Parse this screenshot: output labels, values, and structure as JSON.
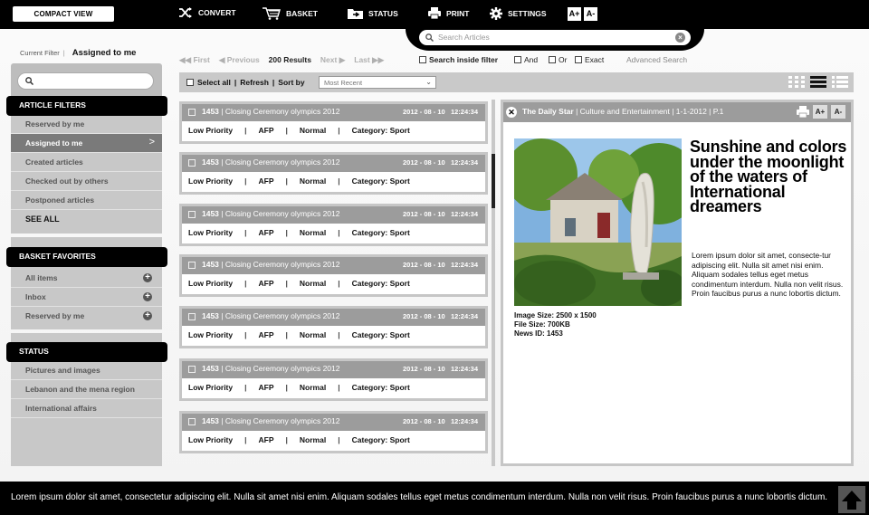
{
  "topbar": {
    "compact_view": "COMPACT VIEW",
    "convert": "CONVERT",
    "basket": "BASKET",
    "status": "STATUS",
    "print": "PRINT",
    "settings": "SETTINGS",
    "font_plus": "A+",
    "font_minus": "A-",
    "search_placeholder": "Search Articles"
  },
  "filter": {
    "label": "Current Filter",
    "value": "Assigned to me"
  },
  "article_filters": {
    "title": "ARTICLE FILTERS",
    "items": [
      "Reserved by me",
      "Assigned to me",
      "Created articles",
      "Checked out by others",
      "Postponed articles",
      "SEE ALL"
    ]
  },
  "basket_favorites": {
    "title": "BASKET FAVORITES",
    "items": [
      "All items",
      "Inbox",
      "Reserved by me"
    ]
  },
  "status_section": {
    "title": "STATUS",
    "items": [
      "Pictures and images",
      "Lebanon and the mena region",
      "International affairs"
    ]
  },
  "pager": {
    "first": "First",
    "previous": "Previous",
    "results": "200 Results",
    "next": "Next",
    "last": "Last"
  },
  "search_options": {
    "inside": "Search inside filter",
    "and": "And",
    "or": "Or",
    "exact": "Exact",
    "advanced": "Advanced Search"
  },
  "toolbar": {
    "select_all": "Select all",
    "refresh": "Refresh",
    "sort_by": "Sort by",
    "sort_value": "Most Recent"
  },
  "articles": [
    {
      "id": "1453",
      "title": "| Closing Ceremony olympics 2012",
      "date": "2012 - 08 - 10",
      "time": "12:24:34",
      "priority": "Low Priority",
      "source": "AFP",
      "level": "Normal",
      "category": "Category: Sport"
    },
    {
      "id": "1453",
      "title": "| Closing Ceremony olympics 2012",
      "date": "2012 - 08 - 10",
      "time": "12:24:34",
      "priority": "Low Priority",
      "source": "AFP",
      "level": "Normal",
      "category": "Category: Sport"
    },
    {
      "id": "1453",
      "title": "| Closing Ceremony olympics 2012",
      "date": "2012 - 08 - 10",
      "time": "12:24:34",
      "priority": "Low Priority",
      "source": "AFP",
      "level": "Normal",
      "category": "Category: Sport"
    },
    {
      "id": "1453",
      "title": "| Closing Ceremony olympics 2012",
      "date": "2012 - 08 - 10",
      "time": "12:24:34",
      "priority": "Low Priority",
      "source": "AFP",
      "level": "Normal",
      "category": "Category: Sport"
    },
    {
      "id": "1453",
      "title": "| Closing Ceremony olympics 2012",
      "date": "2012 - 08 - 10",
      "time": "12:24:34",
      "priority": "Low Priority",
      "source": "AFP",
      "level": "Normal",
      "category": "Category: Sport"
    },
    {
      "id": "1453",
      "title": "| Closing Ceremony olympics 2012",
      "date": "2012 - 08 - 10",
      "time": "12:24:34",
      "priority": "Low Priority",
      "source": "AFP",
      "level": "Normal",
      "category": "Category: Sport"
    },
    {
      "id": "1453",
      "title": "| Closing Ceremony olympics 2012",
      "date": "2012 - 08 - 10",
      "time": "12:24:34",
      "priority": "Low Priority",
      "source": "AFP",
      "level": "Normal",
      "category": "Category: Sport"
    }
  ],
  "preview": {
    "source": "The Daily Star",
    "meta": "| Culture and Entertainment | 1-1-2012 | P.1",
    "font_plus": "A+",
    "font_minus": "A-",
    "headline": "Sunshine and colors under the moonlight of the waters of International dreamers",
    "body": "Lorem ipsum dolor sit amet, consecte-tur adipiscing elit. Nulla sit amet nisi enim. Aliquam sodales tellus eget metus condimentum interdum. Nulla non velit risus. Proin faucibus purus a nunc lobortis dictum.",
    "image_size": "Image Size: 2500 x 1500",
    "file_size": "File Size: 700KB",
    "news_id": "News ID: 1453"
  },
  "footer": {
    "ticker": "Lorem ipsum dolor sit amet, consectetur adipiscing elit. Nulla sit amet nisi enim. Aliquam sodales tellus eget metus condimentum interdum. Nulla non velit risus. Proin faucibus purus a nunc lobortis dictum."
  }
}
